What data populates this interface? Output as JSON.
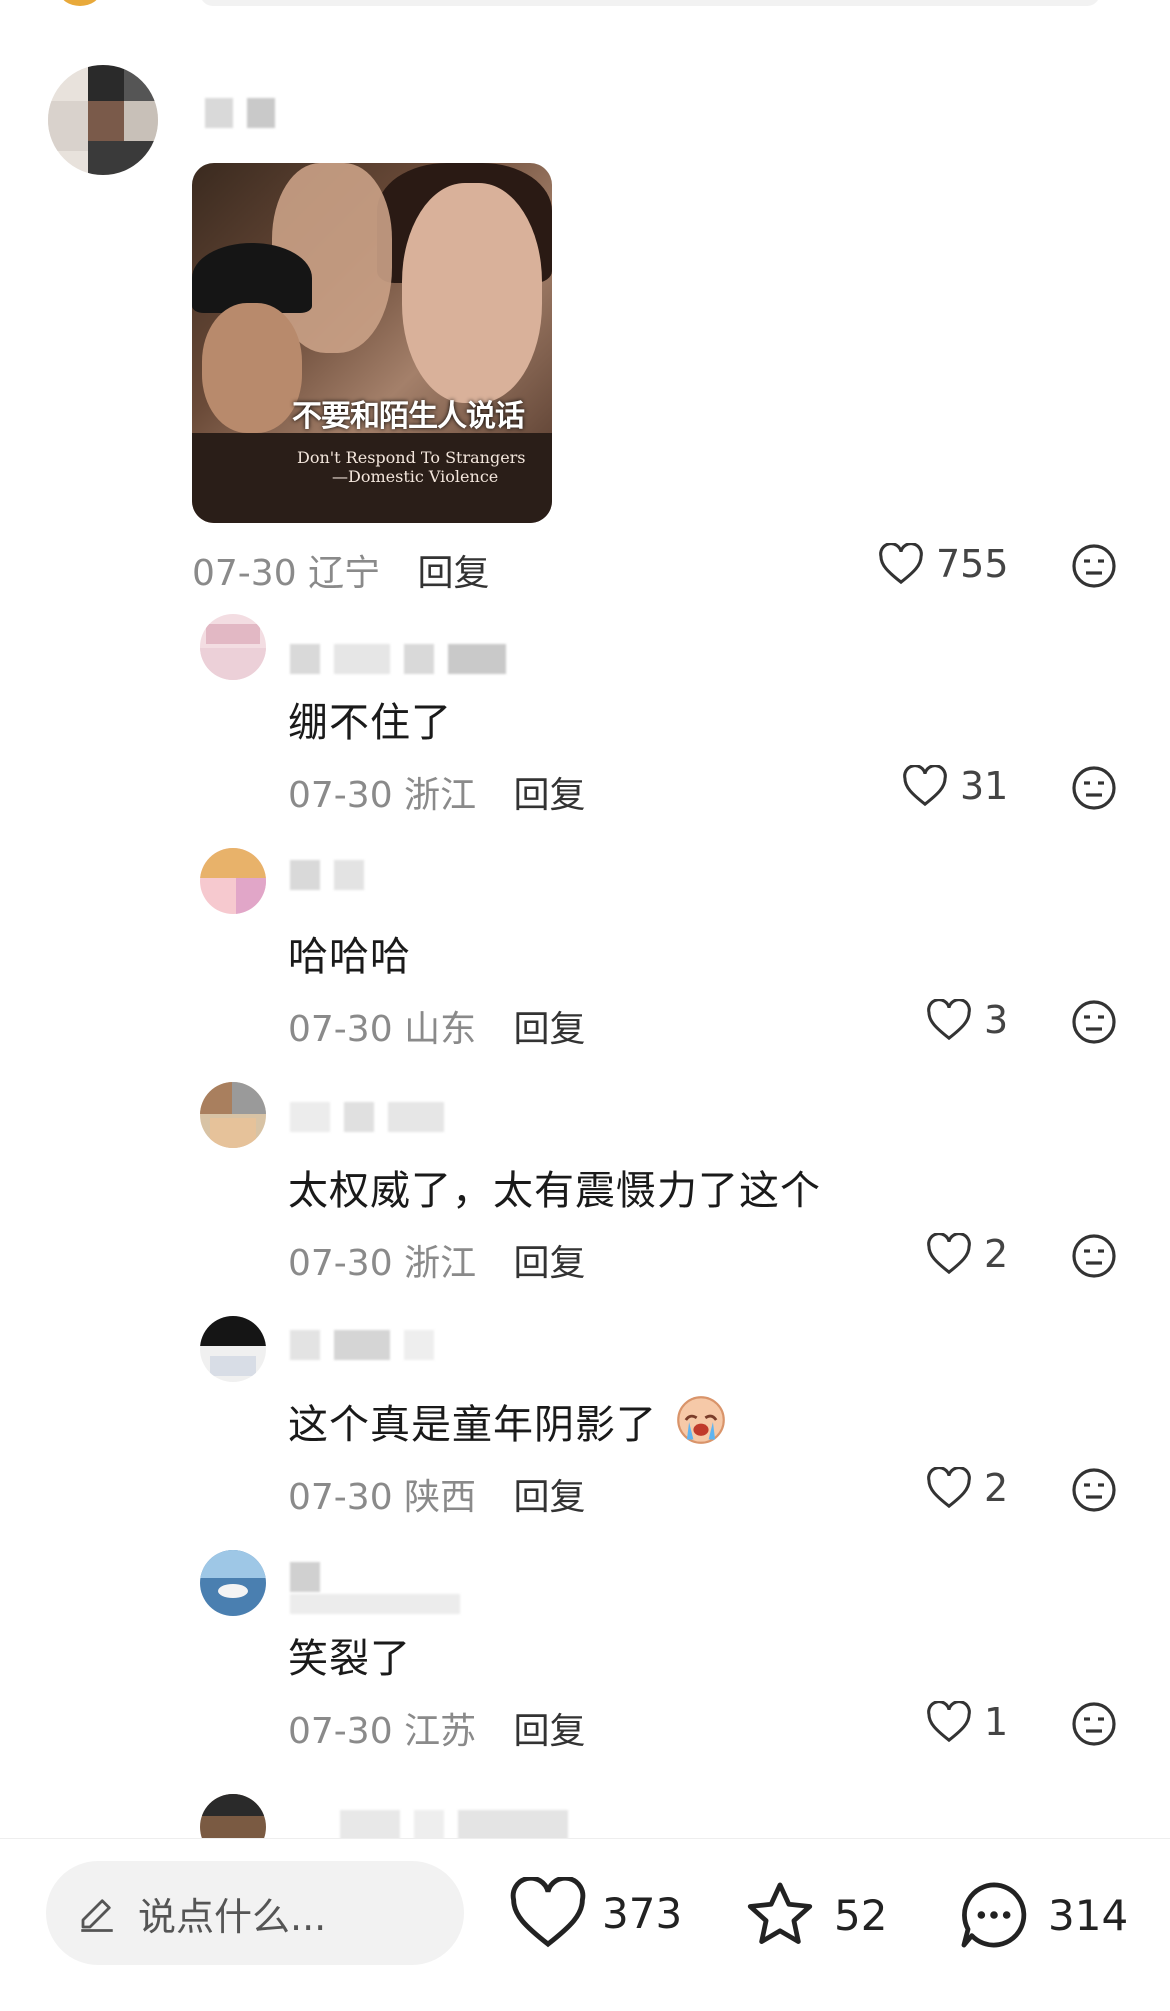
{
  "main_comment": {
    "image_poster": {
      "title_cn": "不要和陌生人说话",
      "subtitle_line1": "Don't   Respond To Strangers",
      "subtitle_line2": "—Domestic Violence"
    },
    "date": "07-30",
    "location": "辽宁",
    "reply_label": "回复",
    "likes": "755"
  },
  "replies": [
    {
      "text": "绷不住了",
      "date": "07-30",
      "location": "浙江",
      "reply_label": "回复",
      "likes": "31"
    },
    {
      "text": "哈哈哈",
      "date": "07-30",
      "location": "山东",
      "reply_label": "回复",
      "likes": "3"
    },
    {
      "text": "太权威了，太有震慑力了这个",
      "date": "07-30",
      "location": "浙江",
      "reply_label": "回复",
      "likes": "2"
    },
    {
      "text": "这个真是童年阴影了",
      "emoji": "crying-face-icon",
      "date": "07-30",
      "location": "陕西",
      "reply_label": "回复",
      "likes": "2"
    },
    {
      "text": "笑裂了",
      "date": "07-30",
      "location": "江苏",
      "reply_label": "回复",
      "likes": "1"
    }
  ],
  "bottom_bar": {
    "input_placeholder": "说点什么...",
    "likes": "373",
    "favorites": "52",
    "comments": "314"
  }
}
